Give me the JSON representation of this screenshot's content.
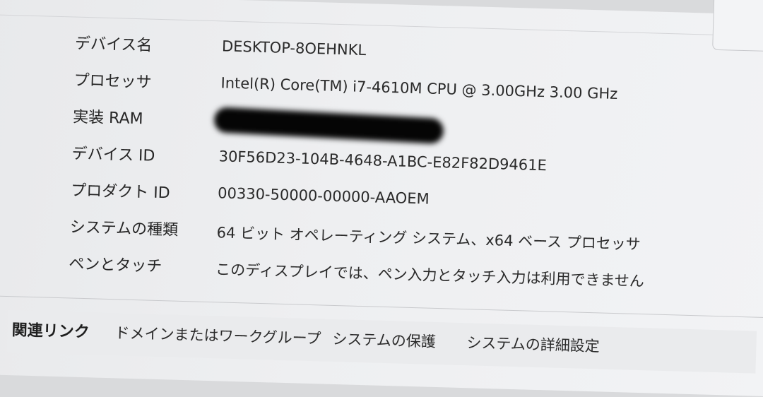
{
  "device_specs": [
    {
      "label": "デバイス名",
      "value": "DESKTOP-8OEHNKL"
    },
    {
      "label": "プロセッサ",
      "value": "Intel(R) Core(TM) i7-4610M CPU @ 3.00GHz   3.00 GHz"
    },
    {
      "label": "実装 RAM",
      "value": ""
    },
    {
      "label": "デバイス ID",
      "value": "30F56D23-104B-4648-A1BC-E82F82D9461E"
    },
    {
      "label": "プロダクト ID",
      "value": "00330-50000-00000-AAOEM"
    },
    {
      "label": "システムの種類",
      "value": "64 ビット オペレーティング システム、x64 ベース プロセッサ"
    },
    {
      "label": "ペンとタッチ",
      "value": "このディスプレイでは、ペン入力とタッチ入力は利用できません"
    }
  ],
  "related_links": {
    "title": "関連リンク",
    "items": [
      "ドメインまたはワークグループ",
      "システムの保護",
      "システムの詳細設定"
    ]
  }
}
